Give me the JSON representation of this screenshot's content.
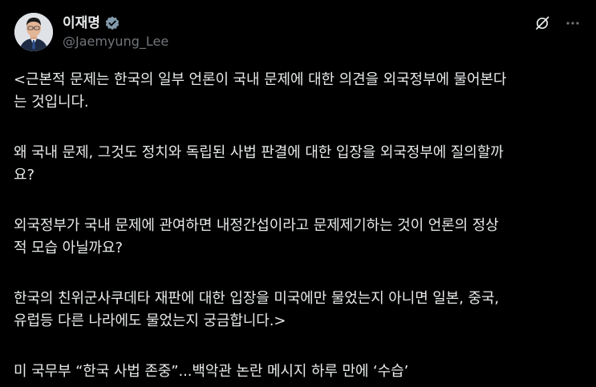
{
  "author": {
    "display_name": "이재명",
    "handle": "@Jaemyung_Lee",
    "verified_icon": "verified-badge-icon",
    "verified_color": "#829aab"
  },
  "actions": {
    "grok_icon": "grok-icon",
    "more_icon": "more-dots-icon"
  },
  "post": {
    "paragraphs": [
      {
        "lines": [
          "<근본적 문제는 한국의 일부 언론이 국내 문제에 대한 의견을 외국정부에 물어본다",
          "는 것입니다."
        ]
      },
      {
        "lines": [
          "왜 국내 문제, 그것도 정치와 독립된 사법 판결에 대한 입장을 외국정부에 질의할까",
          "요?"
        ]
      },
      {
        "lines": [
          "외국정부가 국내 문제에 관여하면 내정간섭이라고 문제제기하는 것이 언론의 정상",
          "적 모습 아닐까요?"
        ]
      },
      {
        "lines": [
          "한국의 친위군사쿠데타 재판에 대한 입장을 미국에만 물었는지 아니면 일본, 중국,",
          "유럽등 다른 나라에도 물었는지 궁금합니다.>"
        ]
      },
      {
        "lines": [
          "미 국무부 “한국 사법 존중”...백악관 논란 메시지 하루 만에 ‘수습’"
        ]
      }
    ]
  },
  "colors": {
    "background": "#000000",
    "text_primary": "#e7e9ea",
    "text_secondary": "#71767b"
  }
}
